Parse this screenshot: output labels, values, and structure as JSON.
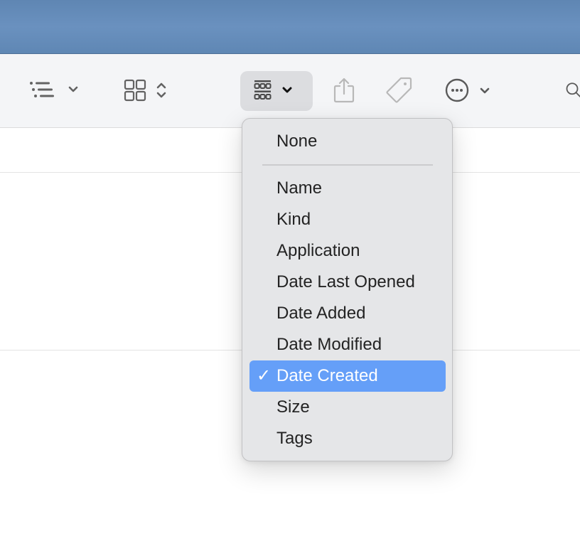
{
  "toolbar": {
    "buttons": [
      {
        "id": "view-list",
        "icon": "list-view-icon",
        "has_dropdown": true
      },
      {
        "id": "view-grid",
        "icon": "icon-grid-icon",
        "has_stepper": true
      },
      {
        "id": "group",
        "icon": "group-by-icon",
        "has_dropdown": true,
        "active": true
      },
      {
        "id": "share",
        "icon": "share-icon",
        "enabled": false
      },
      {
        "id": "tag",
        "icon": "tag-icon",
        "enabled": false
      },
      {
        "id": "more",
        "icon": "ellipsis-circle-icon",
        "has_dropdown": true
      },
      {
        "id": "search",
        "icon": "search-icon"
      }
    ]
  },
  "group_menu": {
    "items": [
      {
        "label": "None",
        "selected": false
      },
      {
        "separator": true
      },
      {
        "label": "Name",
        "selected": false
      },
      {
        "label": "Kind",
        "selected": false
      },
      {
        "label": "Application",
        "selected": false
      },
      {
        "label": "Date Last Opened",
        "selected": false
      },
      {
        "label": "Date Added",
        "selected": false
      },
      {
        "label": "Date Modified",
        "selected": false
      },
      {
        "label": "Date Created",
        "selected": true
      },
      {
        "label": "Size",
        "selected": false
      },
      {
        "label": "Tags",
        "selected": false
      }
    ],
    "checkmark": "✓"
  },
  "colors": {
    "accent": "#659ff8",
    "menu_bg": "#e5e6e8",
    "toolbar_bg": "#f4f5f7",
    "desktop": "#6a91bf"
  }
}
